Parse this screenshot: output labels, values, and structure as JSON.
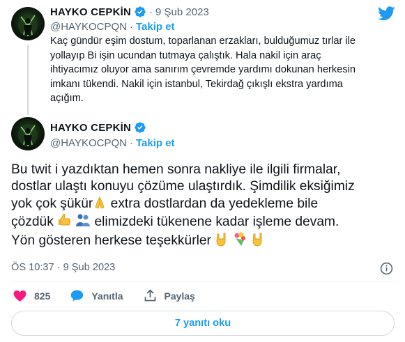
{
  "quoted_tweet": {
    "display_name": "HAYKO CEPKİN",
    "handle": "@HAYKOCPQN",
    "separator": "·",
    "time": "9 Şub 2023",
    "follow_label": "Takip et",
    "text_lines": [
      "Kaç gündür eşim dostum, toparlanan erzakları, bulduğumuz tırlar ile",
      "yollayıp Bi işin ucundan tutmaya çalıştık. Hala nakil için araç",
      "ihtiyacımız oluyor ama sanırım çevremde yardımı dokunan herkesin",
      "imkanı tükendi. Nakil için istanbul, Tekirdağ çıkışlı ekstra yardıma",
      "açığım."
    ]
  },
  "main_tweet": {
    "display_name": "HAYKO CEPKİN",
    "handle": "@HAYKOCPQN",
    "follow_label": "Takip et",
    "text": {
      "line1": "Bu twit i yazdıktan hemen sonra nakliye ile ilgili firmalar,",
      "line2": "dostlar ulaştı konuyu çözüme ulaştırdık. Şimdilik eksiğimiz",
      "line3a": "yok çok şükür",
      "line3b": " extra dostlardan da yedekleme bile",
      "line4a": "çözdük ",
      "line4b": " elimizdeki tükenene kadar işleme devam.",
      "line5": "Yön gösteren herkese teşekkürler "
    },
    "timestamp": "ÖS 10:37 · 9 Şub 2023",
    "likes": "825",
    "reply_label": "Yanıtla",
    "share_label": "Paylaş",
    "replies_button": "7 yanıtı oku"
  },
  "colors": {
    "accent": "#1d9bf0",
    "like": "#f91880",
    "muted": "#536471",
    "border": "#cfd9de"
  },
  "icons": [
    "twitter-bird-icon",
    "verified-badge-icon",
    "info-icon",
    "heart-icon",
    "reply-bubble-icon",
    "share-icon"
  ]
}
